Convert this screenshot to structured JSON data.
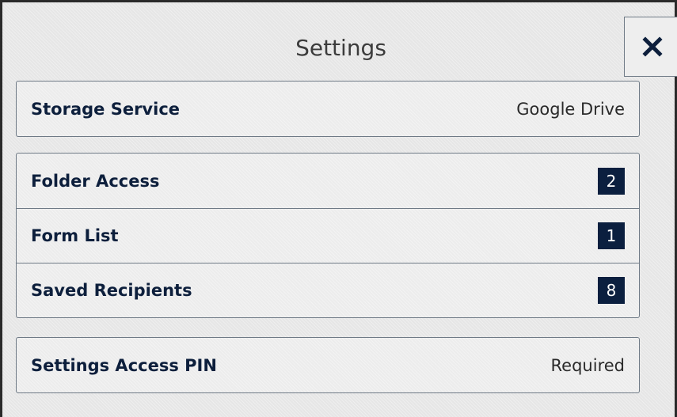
{
  "header": {
    "title": "Settings",
    "close_icon": "close-icon"
  },
  "storage": {
    "label": "Storage Service",
    "value": "Google Drive"
  },
  "lists": [
    {
      "label": "Folder Access",
      "count": "2"
    },
    {
      "label": "Form List",
      "count": "1"
    },
    {
      "label": "Saved Recipients",
      "count": "8"
    }
  ],
  "pin": {
    "label": "Settings Access PIN",
    "value": "Required"
  },
  "colors": {
    "badge": "#0b1f3f",
    "label": "#0d1f3c",
    "border": "#6f7a86"
  }
}
